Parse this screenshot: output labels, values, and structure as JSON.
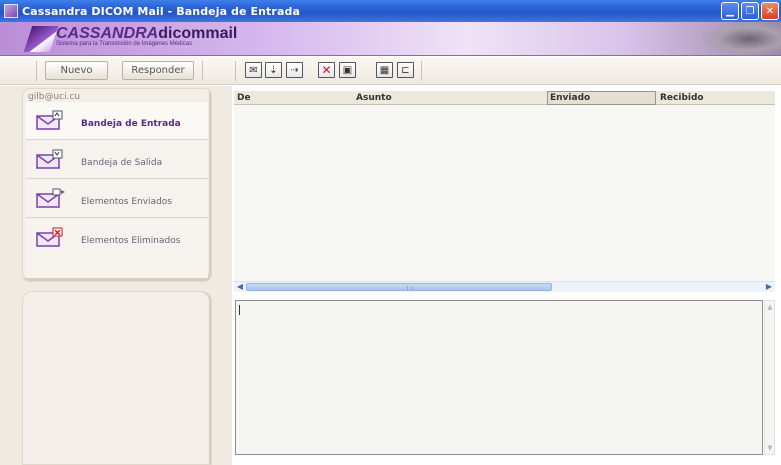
{
  "window": {
    "title": "Cassandra DICOM Mail - Bandeja de Entrada",
    "controls": [
      "minimize",
      "maximize",
      "close"
    ]
  },
  "banner": {
    "logo_italic": "CASSANDRA",
    "logo_rest": "dicommail",
    "subtitle": "Sistema para la Transmisión de Imágenes Médicas"
  },
  "toolbar": {
    "new_label": "Nuevo",
    "reply_label": "Responder",
    "icons": [
      "mail-icon",
      "move-to-folder-icon",
      "move-out-icon",
      "delete-icon",
      "image-icon",
      "dicom-send-icon",
      "connector-icon"
    ]
  },
  "sidebar": {
    "account": "gilb@uci.cu",
    "folders": [
      {
        "label": "Bandeja de Entrada",
        "icon": "inbox-envelope-icon",
        "active": true
      },
      {
        "label": "Bandeja de Salida",
        "icon": "outbox-envelope-icon",
        "active": false
      },
      {
        "label": "Elementos Enviados",
        "icon": "sent-envelope-icon",
        "active": false
      },
      {
        "label": "Elementos Eliminados",
        "icon": "deleted-envelope-icon",
        "active": false
      }
    ]
  },
  "message_list": {
    "columns": [
      "De",
      "Asunto",
      "Enviado",
      "Recibido"
    ],
    "sorted_column": "Enviado",
    "rows": []
  },
  "colors": {
    "titlebar": "#2456c8",
    "accent": "#5b2a86",
    "panel": "#efeae2"
  }
}
